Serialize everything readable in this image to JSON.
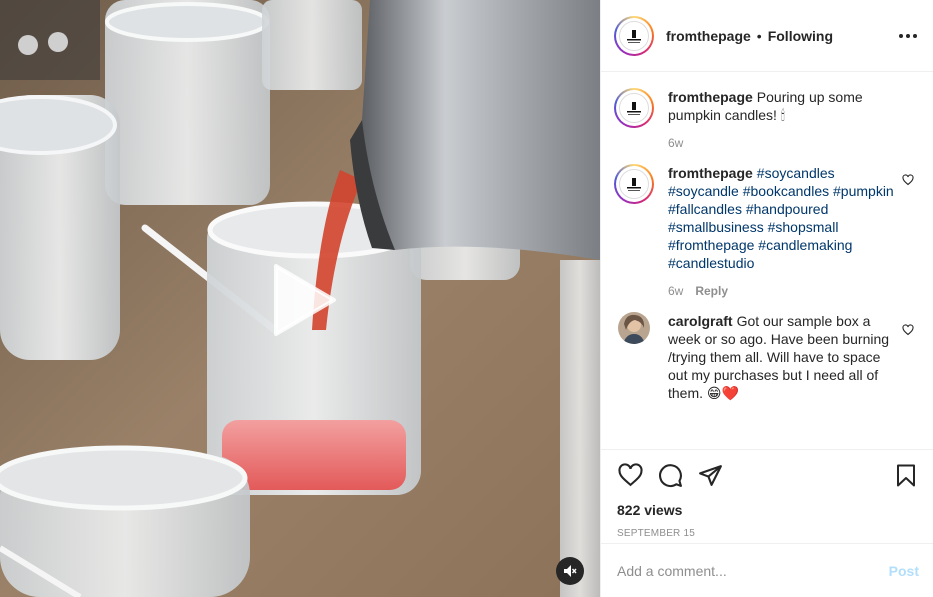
{
  "post": {
    "author": "fromthepage",
    "follow_separator": "•",
    "follow_status": "Following",
    "more_icon": "ellipsis-icon"
  },
  "caption": {
    "user": "fromthepage",
    "text": "Pouring up some pumpkin candles! 🕯",
    "age": "6w"
  },
  "hashtag_comment": {
    "user": "fromthepage",
    "tags": [
      "#soycandles",
      "#soycandle",
      "#bookcandles",
      "#pumpkin",
      "#fallcandles",
      "#handpoured",
      "#smallbusiness",
      "#shopsmall",
      "#fromthepage",
      "#candlemaking",
      "#candlestudio"
    ],
    "age": "6w",
    "reply_label": "Reply"
  },
  "user_comment": {
    "user": "carolgraft",
    "text": "Got our sample box a week or so ago. Have been burning /trying them all. Will have to space out my purchases but I need all of them. 😁❤️"
  },
  "actions": {
    "views": "822 views",
    "date": "SEPTEMBER 15"
  },
  "add_comment": {
    "placeholder": "Add a comment...",
    "post_label": "Post"
  },
  "colors": {
    "accent_link": "#00376b",
    "post_disabled": "#b2dffc",
    "wax": "#e8525a"
  }
}
